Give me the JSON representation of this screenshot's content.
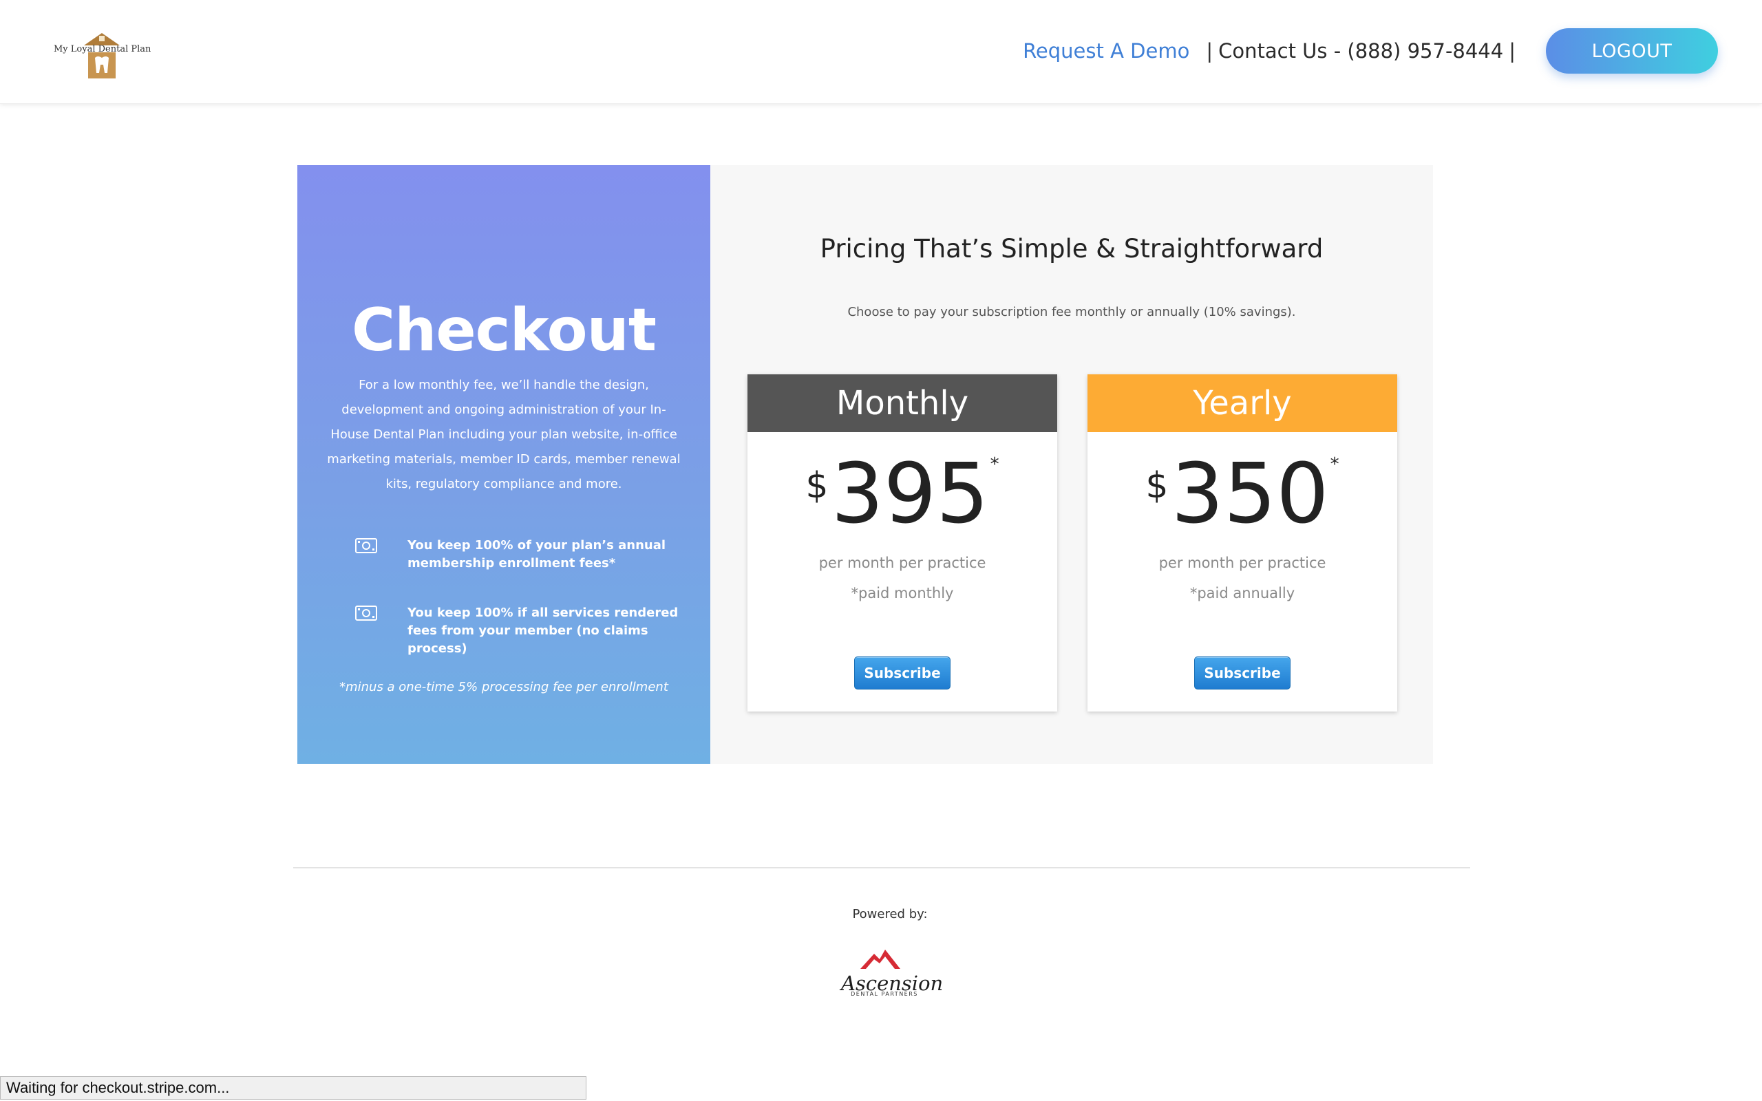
{
  "header": {
    "logo_text": "My Loyal Dental Plan",
    "request_demo": "Request A Demo",
    "separator": "|",
    "contact": "Contact Us - (888) 957-8444",
    "logout": "LOGOUT"
  },
  "checkout": {
    "title": "Checkout",
    "description": "For a low monthly fee, we’ll handle the design, development and ongoing administration of your In-House Dental Plan including your plan website, in-office marketing materials, member ID cards, member renewal kits, regulatory compliance and more.",
    "perks": [
      {
        "icon": "money-icon",
        "text": "You keep 100% of your plan’s annual membership enrollment fees*"
      },
      {
        "icon": "money-icon",
        "text": "You keep 100% if all services rendered fees from your member (no claims process)"
      }
    ],
    "footnote": "*minus a one-time 5% processing fee per enrollment"
  },
  "pricing": {
    "title": "Pricing That’s Simple & Straightforward",
    "subtitle": "Choose to pay your subscription fee monthly or annually (10% savings).",
    "plans": [
      {
        "name": "Monthly",
        "currency": "$",
        "amount": "395",
        "asterisk": "*",
        "per": "per month per practice",
        "billing": "*paid monthly",
        "button": "Subscribe",
        "header_color": "#555555"
      },
      {
        "name": "Yearly",
        "currency": "$",
        "amount": "350",
        "asterisk": "*",
        "per": "per month per practice",
        "billing": "*paid annually",
        "button": "Subscribe",
        "header_color": "#fdab34"
      }
    ]
  },
  "footer": {
    "powered_by": "Powered by:",
    "partner_logo_word": "Ascension",
    "partner_logo_sub": "DENTAL PARTNERS"
  },
  "status_bar": {
    "text": "Waiting for checkout.stripe.com..."
  }
}
